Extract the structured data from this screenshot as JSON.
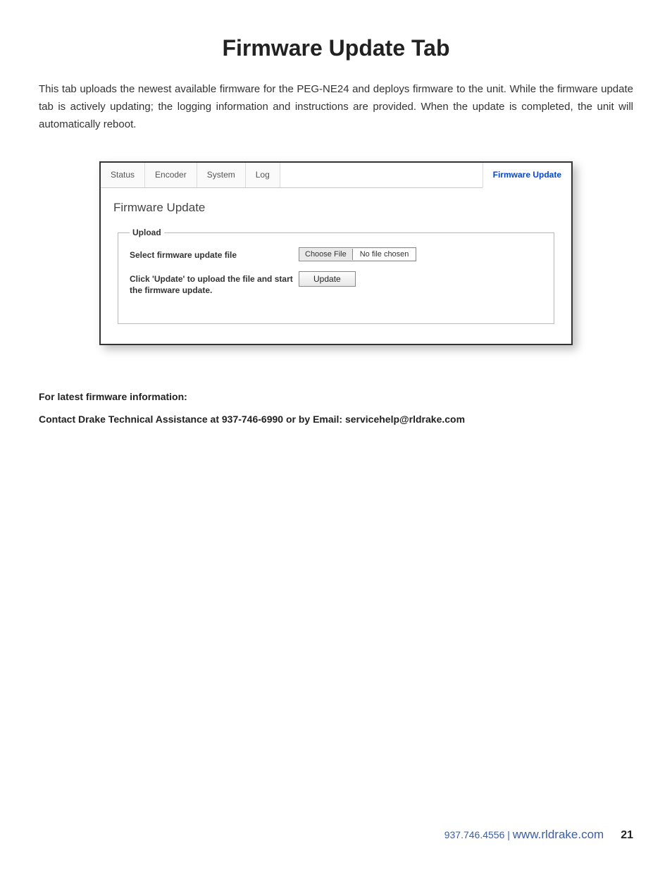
{
  "title": "Firmware Update Tab",
  "intro": "This tab uploads the newest available firmware for the PEG-NE24 and deploys firmware to the unit. While the firmware update tab is actively updating; the logging information and instructions are provided. When the update is completed, the unit will automatically reboot.",
  "tabs": {
    "status": "Status",
    "encoder": "Encoder",
    "system": "System",
    "log": "Log",
    "firmware_update": "Firmware Update"
  },
  "panel": {
    "heading": "Firmware Update",
    "legend": "Upload",
    "select_label": "Select firmware update file",
    "choose_file": "Choose File",
    "no_file": "No file chosen",
    "update_instruction": "Click 'Update' to upload the file and start the firmware update.",
    "update_button": "Update"
  },
  "info": {
    "line1": "For latest firmware information:",
    "line2": "Contact Drake Technical Assistance at 937-746-6990 or by Email: servicehelp@rldrake.com"
  },
  "footer": {
    "phone": "937.746.4556",
    "sep": "|",
    "url": "www.rldrake.com",
    "page": "21"
  }
}
